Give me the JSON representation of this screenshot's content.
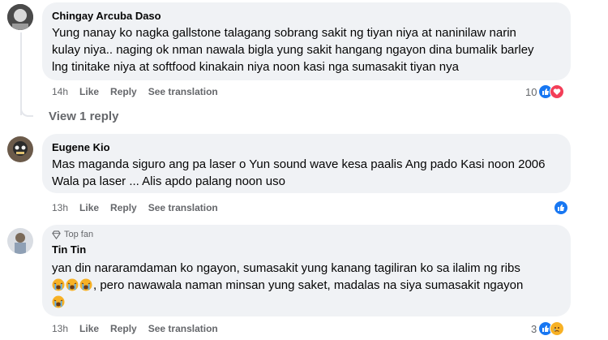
{
  "comments": [
    {
      "author": "Chingay Arcuba Daso",
      "text": "Yung nanay ko nagka gallstone talagang sobrang sakit ng tiyan niya at naninilaw narin kulay niya.. naging ok nman nawala bigla yung sakit hangang ngayon dina bumalik barley lng tinitake niya at softfood kinakain niya noon kasi nga sumasakit tiyan nya",
      "time": "14h",
      "like": "Like",
      "reply": "Reply",
      "see_translation": "See translation",
      "reaction_count": "10",
      "reaction_icons": [
        "like-icon",
        "love-icon"
      ]
    },
    {
      "author": "Eugene Kio",
      "text": "Mas maganda siguro ang pa laser o Yun sound wave kesa paalis Ang pado Kasi noon 2006 Wala pa laser ... Alis apdo palang noon uso",
      "time": "13h",
      "like": "Like",
      "reply": "Reply",
      "see_translation": "See translation",
      "reaction_count": "",
      "reaction_icons": [
        "like-icon"
      ]
    },
    {
      "badge": "Top fan",
      "author": "Tin Tin",
      "text_line1": "yan din nararamdaman ko ngayon, sumasakit yung kanang tagiliran ko sa ilalim ng ribs",
      "text_line2": ", pero nawawala naman minsan yung saket, madalas na siya sumasakit ngayon",
      "time": "13h",
      "like": "Like",
      "reply": "Reply",
      "see_translation": "See translation",
      "reaction_count": "3",
      "reaction_icons": [
        "like-icon",
        "sad-icon"
      ]
    }
  ],
  "view_replies": "View 1 reply",
  "colors": {
    "like_blue": "#1877f2",
    "love_red": "#f33e58",
    "sad_yellow": "#f7b125",
    "bubble": "#f0f2f5",
    "meta": "#65676b"
  }
}
